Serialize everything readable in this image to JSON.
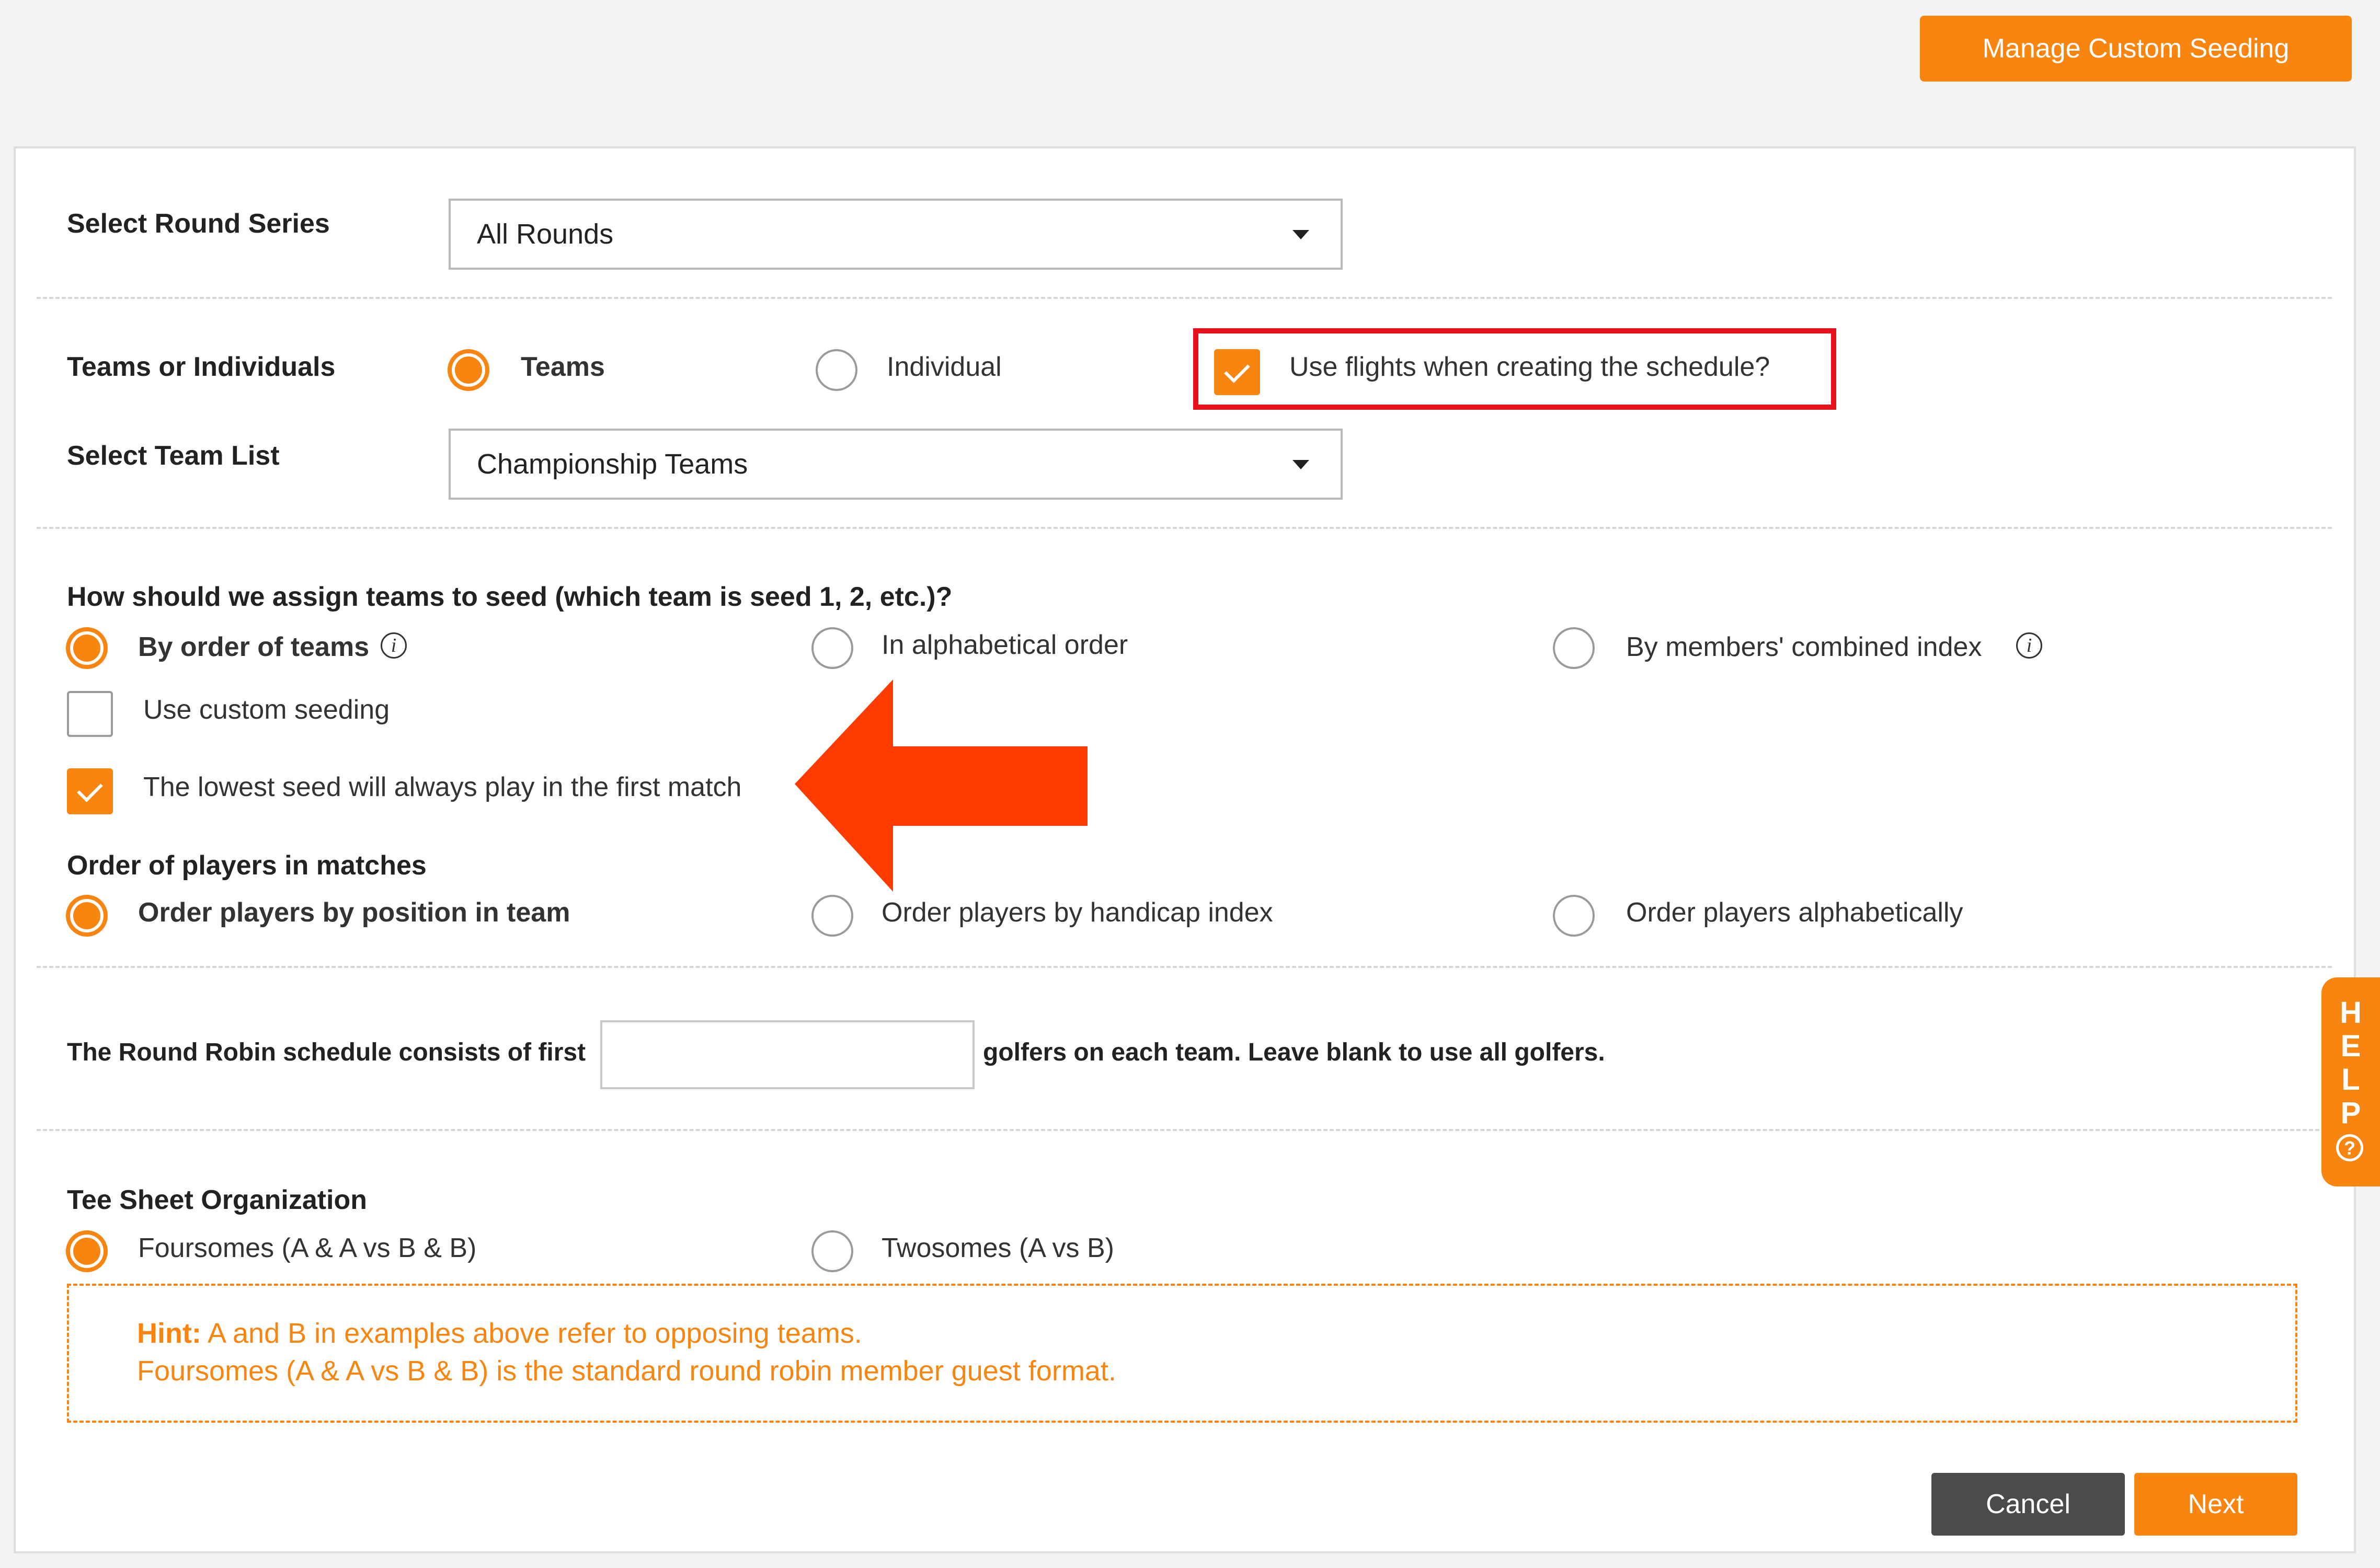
{
  "header": {
    "manage_seeding_label": "Manage Custom Seeding"
  },
  "round_series": {
    "label": "Select Round Series",
    "value": "All Rounds"
  },
  "teams_or_individuals": {
    "label": "Teams or Individuals",
    "options": [
      "Teams",
      "Individual"
    ],
    "selected": "Teams",
    "use_flights_label": "Use flights when creating the schedule?",
    "use_flights_checked": true
  },
  "team_list": {
    "label": "Select Team List",
    "value": "Championship Teams"
  },
  "seed_assignment": {
    "question": "How should we assign teams to seed (which team is seed 1, 2, etc.)?",
    "options": [
      "By order of teams",
      "In alphabetical order",
      "By members' combined index"
    ],
    "selected": "By order of teams",
    "custom_seeding_label": "Use custom seeding",
    "custom_seeding_checked": false,
    "lowest_seed_label": "The lowest seed will always play in the first match",
    "lowest_seed_checked": true
  },
  "player_order": {
    "label": "Order of players in matches",
    "options": [
      "Order players by position in team",
      "Order players by handicap index",
      "Order players alphabetically"
    ],
    "selected": "Order players by position in team"
  },
  "round_robin": {
    "prefix": "The Round Robin schedule consists of first",
    "suffix": "golfers on each team. Leave blank to use all golfers.",
    "value": ""
  },
  "tee_sheet": {
    "label": "Tee Sheet Organization",
    "options": [
      "Foursomes (A & A vs B & B)",
      "Twosomes (A vs B)"
    ],
    "selected": "Foursomes (A & A vs B & B)"
  },
  "hint": {
    "prefix": "Hint:",
    "line1": "A and B in examples above refer to opposing teams.",
    "line2": "Foursomes (A & A vs B & B) is the standard round robin member guest format."
  },
  "footer": {
    "cancel_label": "Cancel",
    "next_label": "Next"
  },
  "help_tab": {
    "letters": [
      "H",
      "E",
      "L",
      "P"
    ],
    "icon": "?"
  },
  "colors": {
    "accent": "#f98511",
    "highlight_box": "#e8121c",
    "arrow": "#ff3b00",
    "cancel_button": "#4b4b4b"
  }
}
